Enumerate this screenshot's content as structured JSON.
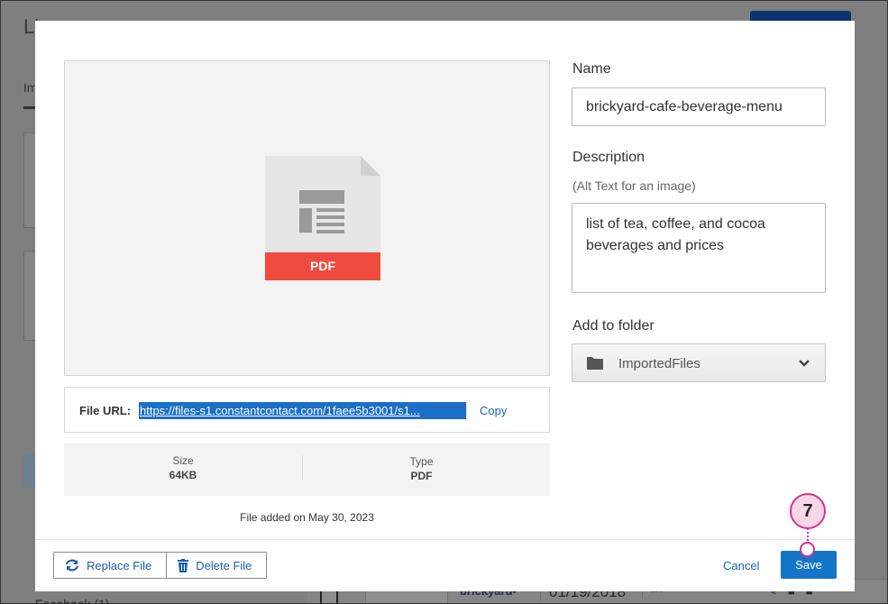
{
  "background": {
    "title": "Li",
    "tab": "Im",
    "row": {
      "name": "brickyard-",
      "date": "01/19/2018",
      "dash": "---"
    },
    "left_bottom": "Facebook (1)"
  },
  "modal": {
    "preview": {
      "file_badge": "PDF",
      "icon": "pdf-document-icon"
    },
    "file_url": {
      "label": "File URL:",
      "value": "https://files-s1.constantcontact.com/1faee5b3001/s1...",
      "copy_label": "Copy"
    },
    "meta": {
      "size_label": "Size",
      "size_value": "64KB",
      "type_label": "Type",
      "type_value": "PDF"
    },
    "added_text": "File added on May 30, 2023",
    "name": {
      "label": "Name",
      "value": "brickyard-cafe-beverage-menu"
    },
    "description": {
      "label": "Description",
      "sublabel": "(Alt Text for an image)",
      "value": "list of tea, coffee, and cocoa beverages and prices"
    },
    "folder": {
      "label": "Add to folder",
      "value": "ImportedFiles",
      "icon": "folder-icon"
    },
    "footer": {
      "replace_label": "Replace File",
      "delete_label": "Delete File",
      "cancel_label": "Cancel",
      "save_label": "Save"
    }
  },
  "callout": {
    "step": "7"
  },
  "colors": {
    "accent": "#1474c8",
    "pdf_red": "#f04a3f",
    "callout_pink": "#d2358a"
  }
}
